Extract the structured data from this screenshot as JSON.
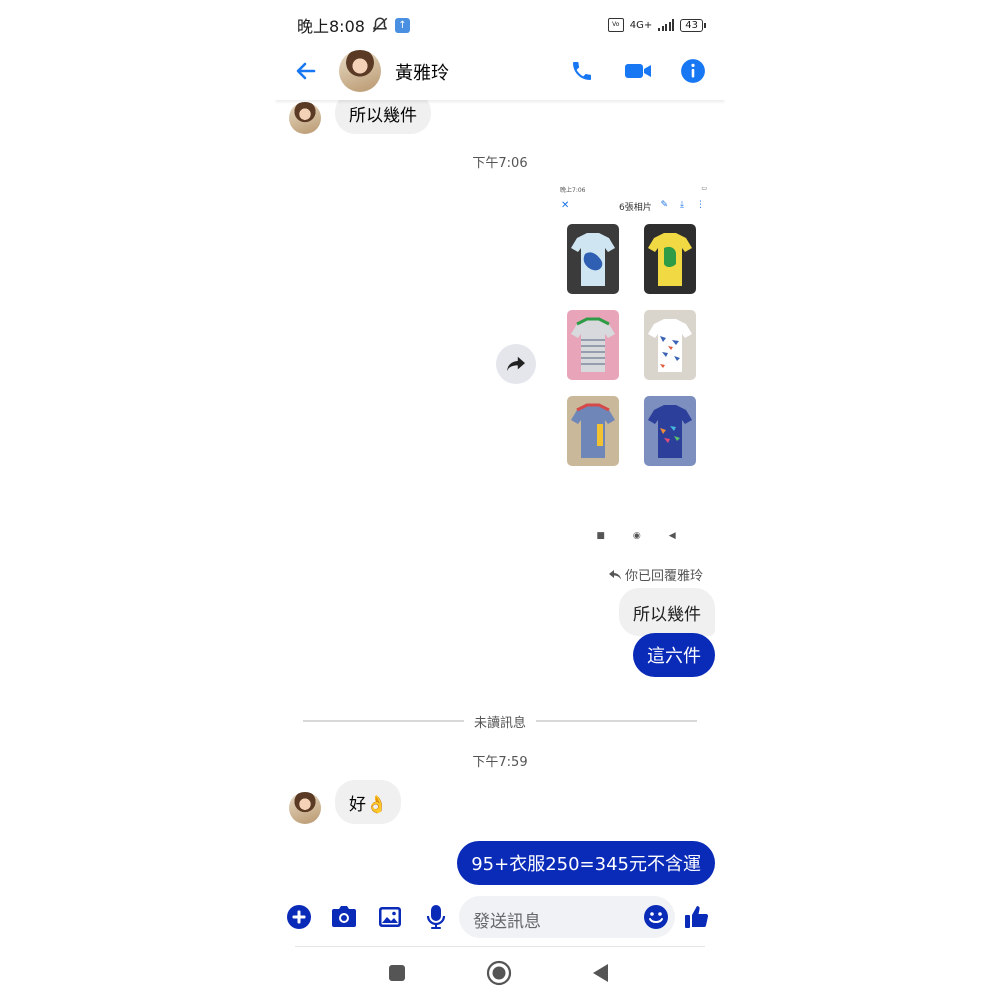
{
  "status_bar": {
    "time": "晚上8:08",
    "network": "4G+",
    "battery": "43"
  },
  "header": {
    "contact_name": "黃雅玲",
    "icons": [
      "back-arrow-icon",
      "phone-icon",
      "video-camera-icon",
      "info-icon"
    ],
    "accent_color": "#1877f2"
  },
  "messages": {
    "incoming_1": "所以幾件",
    "timestamp_1": "下午7:06",
    "shared_screenshot": {
      "title": "6張相片",
      "status_time": "晚上7:06"
    },
    "reply_note": "你已回覆雅玲",
    "quoted_reply": "所以幾件",
    "outgoing_1": "這六件",
    "unread_divider": "未讀訊息",
    "timestamp_2": "下午7:59",
    "incoming_2": "好👌",
    "outgoing_2": "95+衣服250=345元不含運",
    "outgoing_bubble_color": "#0a2ab8"
  },
  "composer": {
    "placeholder": "發送訊息",
    "icons": [
      "plus-icon",
      "camera-icon",
      "image-icon",
      "microphone-icon",
      "emoji-icon",
      "thumbs-up-icon"
    ]
  },
  "navigation_bar": {
    "icons": [
      "recent-apps-icon",
      "home-icon",
      "back-icon"
    ]
  }
}
